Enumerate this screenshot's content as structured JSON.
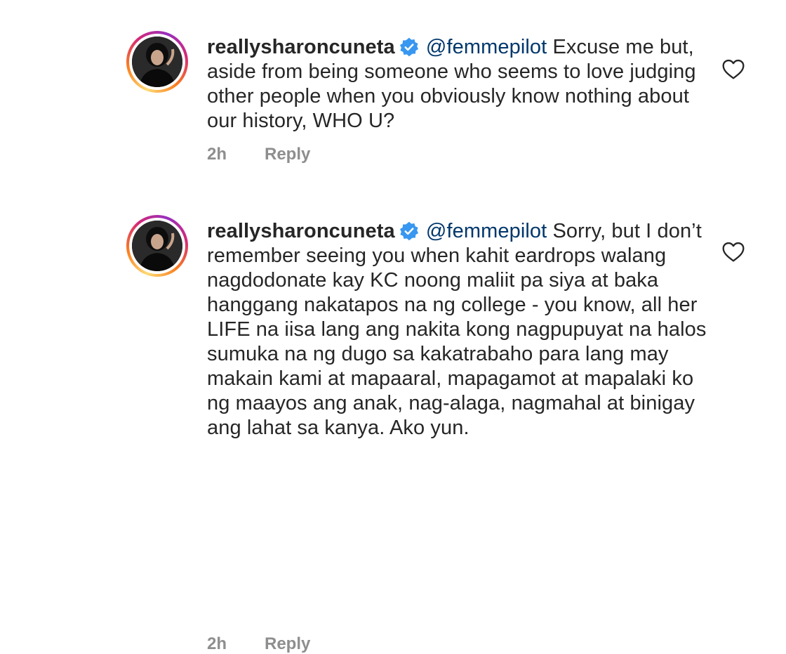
{
  "comments": [
    {
      "username": "reallysharoncuneta",
      "mention": "@femmepilot",
      "text": "Excuse me but, aside from being someone who seems to love judging other people when you obviously know nothing about our history, WHO U?",
      "time": "2h",
      "reply_label": "Reply",
      "verified": true
    },
    {
      "username": "reallysharoncuneta",
      "mention": "@femmepilot",
      "text": "Sorry, but I don’t remember seeing you when kahit eardrops walang nagdodonate kay KC noong maliit pa siya at baka hanggang nakatapos na ng college - you know, all her LIFE na iisa lang ang nakita kong nagpupuyat na halos sumuka na ng dugo sa kakatrabaho para lang may makain kami at mapaaral, mapagamot at mapalaki ko ng maayos ang anak, nag-alaga, nagmahal at binigay ang lahat sa kanya. Ako yun.",
      "time": "2h",
      "reply_label": "Reply",
      "verified": true
    }
  ],
  "colors": {
    "verified_badge": "#3897f0",
    "mention": "#00376b",
    "meta": "#8e8e8e"
  }
}
